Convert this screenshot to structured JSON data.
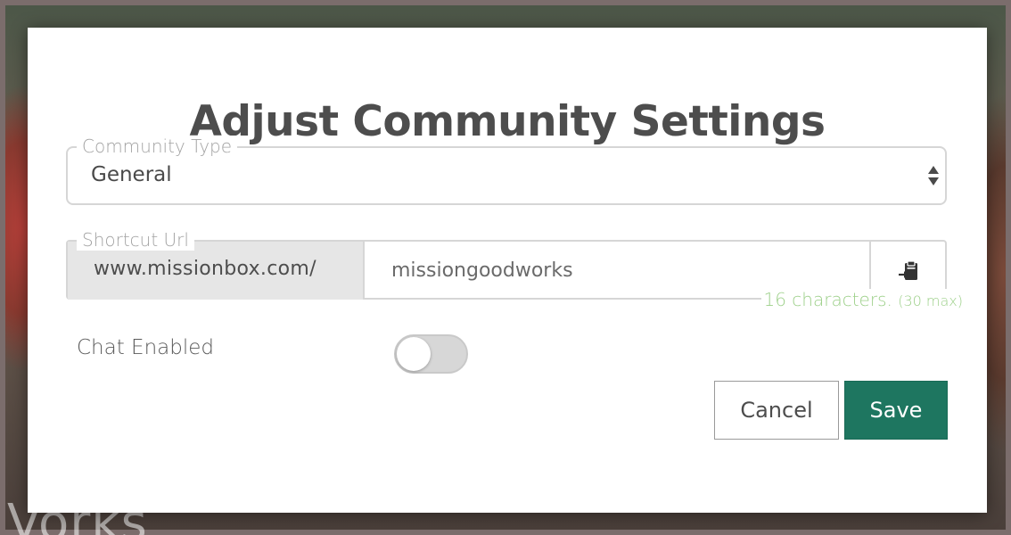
{
  "backdrop": {
    "text": "Vorks"
  },
  "modal": {
    "title": "Adjust Community Settings",
    "community_type": {
      "legend": "Community Type",
      "selected": "General",
      "arrows_icon": "select-arrows-icon"
    },
    "shortcut_url": {
      "legend": "Shortcut Url",
      "prefix": "www.missionbox.com/",
      "value": "missiongoodworks",
      "paste_icon": "clipboard-paste-icon",
      "char_count": "16 characters.",
      "char_max": "(30 max)"
    },
    "chat": {
      "label": "Chat Enabled",
      "enabled": false
    },
    "buttons": {
      "cancel": "Cancel",
      "save": "Save"
    },
    "colors": {
      "primary": "#1e7660",
      "count_text": "#9dd08a",
      "title_text": "#4d4d4d"
    }
  }
}
